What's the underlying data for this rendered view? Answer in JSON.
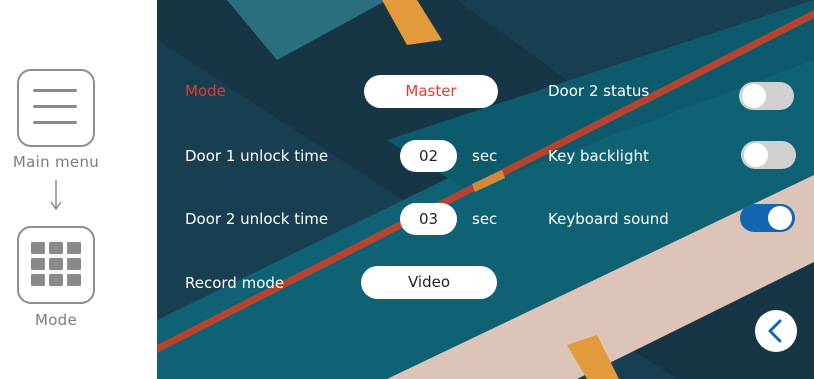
{
  "help": {
    "main_menu_caption": "Main menu",
    "mode_caption": "Mode"
  },
  "settings": {
    "mode": {
      "label": "Mode",
      "value": "Master"
    },
    "door1_unlock": {
      "label": "Door 1 unlock time",
      "value": "02",
      "unit": "sec"
    },
    "door2_unlock": {
      "label": "Door 2 unlock time",
      "value": "03",
      "unit": "sec"
    },
    "record_mode": {
      "label": "Record mode",
      "value": "Video"
    },
    "door2_status": {
      "label": "Door 2 status",
      "on": false
    },
    "key_backlight": {
      "label": "Key backlight",
      "on": false
    },
    "keyboard_sound": {
      "label": "Keyboard sound",
      "on": true
    }
  },
  "colors": {
    "active_label": "#e8392f",
    "toggle_on": "#1367b1",
    "toggle_off": "#d0d0d0"
  },
  "icons": {
    "main_menu": "hamburger-menu-icon",
    "mode": "grid-icon",
    "back": "chevron-left-icon"
  }
}
